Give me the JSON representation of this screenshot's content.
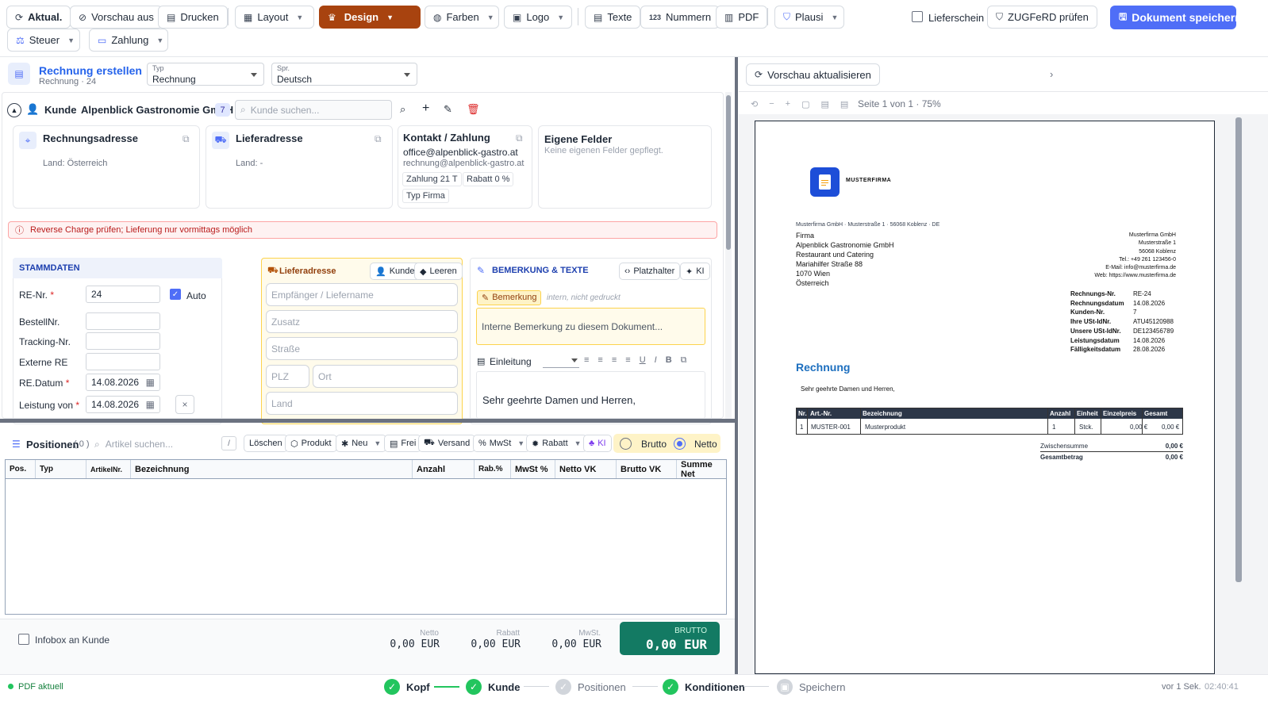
{
  "toolbar": {
    "aktual": "Aktual.",
    "vorschau_aus": "Vorschau aus",
    "drucken": "Drucken",
    "layout": "Layout",
    "design": "Design",
    "farben": "Farben",
    "logo": "Logo",
    "texte": "Texte",
    "nummern": "Nummern",
    "pdf": "PDF",
    "plausi": "Plausi",
    "lieferschein": "Lieferschein",
    "zugferd": "ZUGFeRD prüfen",
    "save": "Dokument speichern",
    "steuer": "Steuer",
    "zahlung": "Zahlung",
    "nummern_icon": "123",
    "accent": "#4f6ef7",
    "design_color": "#a8430f"
  },
  "header": {
    "title": "Rechnung erstellen",
    "subtitle": "Rechnung · 24",
    "typ_label": "Typ",
    "typ_value": "Rechnung",
    "spr_label": "Spr.",
    "spr_value": "Deutsch"
  },
  "kunde": {
    "label": "Kunde",
    "name": "Alpenblick Gastronomie GmbH",
    "number": "7",
    "search_placeholder": "Kunde suchen..."
  },
  "cards": {
    "rechnungsadresse": "Rechnungsadresse",
    "rechnungsadresse_land": "Land: Österreich",
    "lieferadresse": "Lieferadresse",
    "lieferadresse_land": "Land: -",
    "kontakt": "Kontakt / Zahlung",
    "email1": "office@alpenblick-gastro.at",
    "email2": "rechnung@alpenblick-gastro.at",
    "zahlung": "Zahlung 21 T",
    "rabatt": "Rabatt 0 %",
    "typ": "Typ Firma",
    "eigene": "Eigene Felder",
    "eigene_sub": "Keine eigenen Felder gepflegt."
  },
  "warning": "Reverse Charge prüfen; Lieferung nur vormittags möglich",
  "stammdaten": {
    "title": "STAMMDATEN",
    "re_nr_label": "RE-Nr.",
    "re_nr": "24",
    "auto": "Auto",
    "bestell": "BestellNr.",
    "tracking": "Tracking-Nr.",
    "extern": "Externe RE",
    "datum_label": "RE.Datum",
    "datum": "14.08.2026",
    "leistung_label": "Leistung von",
    "leistung": "14.08.2026",
    "req": "*",
    "clear": "×"
  },
  "liefer": {
    "title": "Lieferadresse",
    "kunde_btn": "Kunde",
    "leeren_btn": "Leeren",
    "empf": "Empfänger / Liefername",
    "zusatz": "Zusatz",
    "strasse": "Straße",
    "plz": "PLZ",
    "ort": "Ort",
    "land": "Land"
  },
  "bemerkung": {
    "title": "BEMERKUNG & TEXTE",
    "platzhalter": "Platzhalter",
    "ki": "KI",
    "tag": "Bemerkung",
    "tag_hint": "intern, nicht gedruckt",
    "placeholder": "Interne Bemerkung zu diesem Dokument...",
    "einleitung": "Einleitung",
    "body": "Sehr geehrte Damen und Herren,",
    "fmt": [
      "≡",
      "≡",
      "≡",
      "≡",
      "U",
      "I",
      "B",
      "⧉"
    ]
  },
  "positionen": {
    "title": "Positionen",
    "count": "( 0 )",
    "search": "Artikel suchen...",
    "slash": "/",
    "loeschen": "Löschen",
    "produkt": "Produkt",
    "neu": "Neu",
    "frei": "Frei",
    "versand": "Versand",
    "mwst": "MwSt",
    "rabatt": "Rabatt",
    "ki": "KI",
    "brutto": "Brutto",
    "netto": "Netto",
    "columns": [
      "Pos.",
      "Typ",
      "ArtikelNr.",
      "Bezeichnung",
      "Anzahl",
      "Rab.%",
      "MwSt %",
      "Netto VK",
      "Brutto VK",
      "Summe Net"
    ]
  },
  "totals": {
    "infobox": "Infobox an Kunde",
    "netto_label": "Netto",
    "netto": "0,00 EUR",
    "rabatt_label": "Rabatt",
    "rabatt": "0,00 EUR",
    "mwst_label": "MwSt.",
    "mwst": "0,00 EUR",
    "brutto_label": "BRUTTO",
    "brutto": "0,00 EUR"
  },
  "preview": {
    "refresh": "Vorschau aktualisieren",
    "page_info": "Seite 1 von 1 · 75%",
    "zoom_icons": [
      "⟲",
      "−",
      "+",
      "▢",
      "▤",
      "▤"
    ]
  },
  "doc": {
    "logo_name": "MUSTERFIRMA",
    "sender_line": "Musterfirma GmbH · Musterstraße 1 · 56068 Koblenz · DE",
    "recipient": [
      "Firma",
      "Alpenblick Gastronomie GmbH",
      "Restaurant und Catering",
      "Mariahilfer Straße 88",
      "1070 Wien",
      "Österreich"
    ],
    "company": [
      "Musterfirma GmbH",
      "Musterstraße 1",
      "56068 Koblenz",
      "Tel.: +49 261 123456-0",
      "E-Mail: info@musterfirma.de",
      "Web: https://www.musterfirma.de"
    ],
    "meta": [
      [
        "Rechnungs-Nr.",
        "RE-24"
      ],
      [
        "Rechnungsdatum",
        "14.08.2026"
      ],
      [
        "Kunden-Nr.",
        "7"
      ],
      [
        "Ihre USt-IdNr.",
        "ATU45120988"
      ],
      [
        "Unsere USt-IdNr.",
        "DE123456789"
      ],
      [
        "Leistungsdatum",
        "14.08.2026"
      ],
      [
        "Fälligkeitsdatum",
        "28.08.2026"
      ]
    ],
    "title": "Rechnung",
    "greeting": "Sehr geehrte Damen und Herren,",
    "table_head": [
      "Nr.",
      "Art.-Nr.",
      "Bezeichnung",
      "Anzahl",
      "Einheit",
      "Einzelpreis",
      "Gesamt"
    ],
    "table_row": [
      "1",
      "MUSTER-001",
      "Musterprodukt",
      "1",
      "Stck.",
      "0,00 €",
      "0,00 €"
    ],
    "zwischensumme_label": "Zwischensumme",
    "zwischensumme": "0,00 €",
    "gesamt_label": "Gesamtbetrag",
    "gesamt": "0,00 €"
  },
  "status": {
    "pdf": "PDF aktuell",
    "steps": [
      "Kopf",
      "Kunde",
      "Positionen",
      "Konditionen",
      "Speichern"
    ],
    "time": "vor 1 Sek.",
    "clock": "02:40:41"
  }
}
